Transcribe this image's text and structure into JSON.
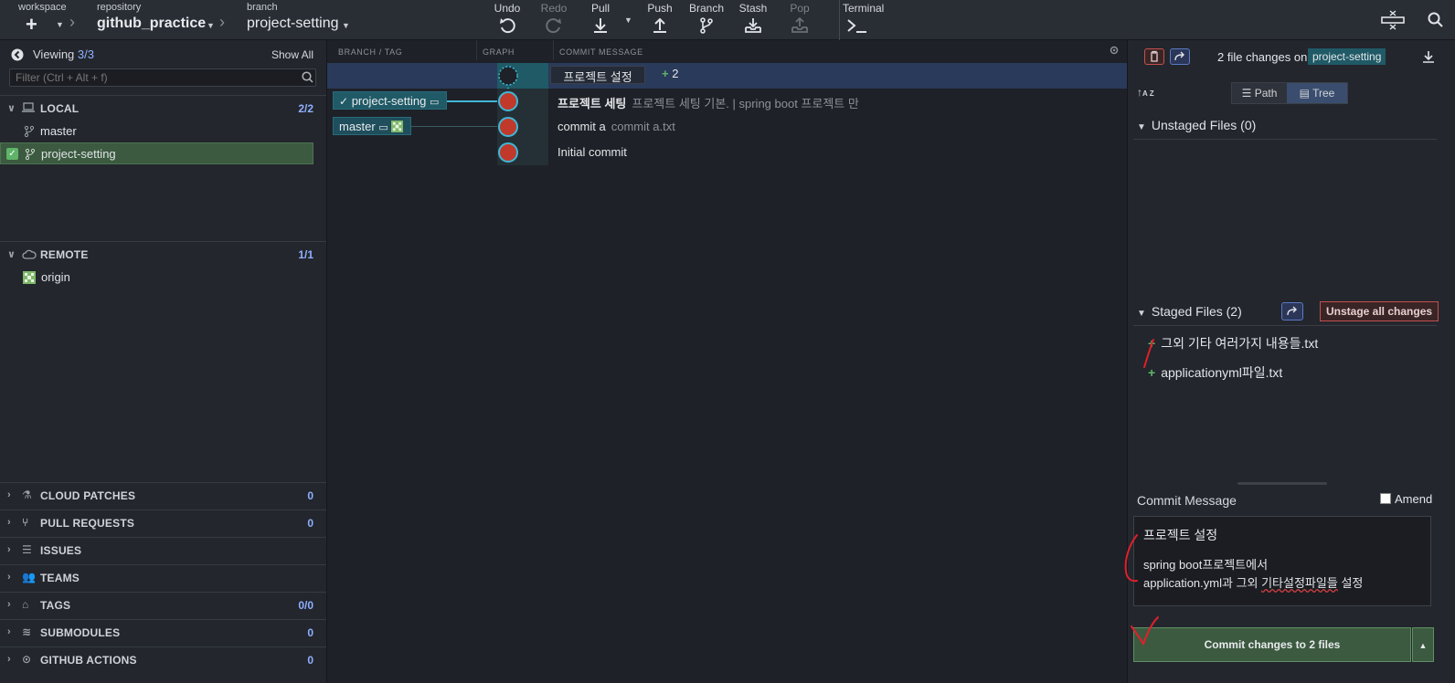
{
  "toolbar": {
    "workspace_label": "workspace",
    "repository_label": "repository",
    "repository_name": "github_practice",
    "branch_label": "branch",
    "branch_name": "project-setting",
    "actions": {
      "undo": "Undo",
      "redo": "Redo",
      "pull": "Pull",
      "push": "Push",
      "branch": "Branch",
      "stash": "Stash",
      "pop": "Pop",
      "terminal": "Terminal"
    }
  },
  "sidebar": {
    "viewing_label": "Viewing",
    "viewing_count": "3/3",
    "show_all": "Show All",
    "filter_placeholder": "Filter (Ctrl + Alt + f)",
    "local": {
      "title": "LOCAL",
      "count": "2/2",
      "branches": [
        "master",
        "project-setting"
      ]
    },
    "remote": {
      "title": "REMOTE",
      "count": "1/1",
      "remotes": [
        "origin"
      ]
    },
    "sections": [
      {
        "title": "CLOUD PATCHES",
        "count": "0"
      },
      {
        "title": "PULL REQUESTS",
        "count": "0"
      },
      {
        "title": "ISSUES",
        "count": ""
      },
      {
        "title": "TEAMS",
        "count": ""
      },
      {
        "title": "TAGS",
        "count": "0/0"
      },
      {
        "title": "SUBMODULES",
        "count": "0"
      },
      {
        "title": "GITHUB ACTIONS",
        "count": "0"
      }
    ]
  },
  "graph": {
    "columns": {
      "branch_tag": "BRANCH / TAG",
      "graph": "GRAPH",
      "commit_message": "COMMIT MESSAGE"
    },
    "wip": {
      "message": "프로젝트 설정",
      "plus_count": "2"
    },
    "commits": [
      {
        "branch": "project-setting",
        "title": "프로젝트 세팅",
        "description": "프로젝트 세팅 기본. | spring boot 프로젝트 만"
      },
      {
        "branch": "master",
        "title": "commit a",
        "description": "commit a.txt"
      },
      {
        "branch": "",
        "title": "Initial commit",
        "description": ""
      }
    ]
  },
  "changes": {
    "summary": "2 file changes on",
    "branch": "project-setting",
    "view_path": "Path",
    "view_tree": "Tree",
    "unstaged_title": "Unstaged Files (0)",
    "staged_title": "Staged Files (2)",
    "unstage_all": "Unstage all changes",
    "staged_files": [
      "그외 기타 여러가지 내용들.txt",
      "applicationyml파일.txt"
    ],
    "commit_message_label": "Commit Message",
    "amend_label": "Amend",
    "commit_summary": "프로젝트 설정",
    "commit_body_line1": "spring boot프로젝트에서",
    "commit_body_line2_a": "application.yml과 그외 ",
    "commit_body_line2_b": "기타설정파일들",
    "commit_body_line2_c": " 설정",
    "commit_button": "Commit changes to 2 files"
  },
  "colors": {
    "accent_blue": "#8fb0ff",
    "node_red": "#c0392b",
    "node_ring": "#3fb7d6",
    "added_green": "#5fb46a",
    "branch_teal": "#1f4e5c",
    "annotation_red": "#e0202a"
  }
}
